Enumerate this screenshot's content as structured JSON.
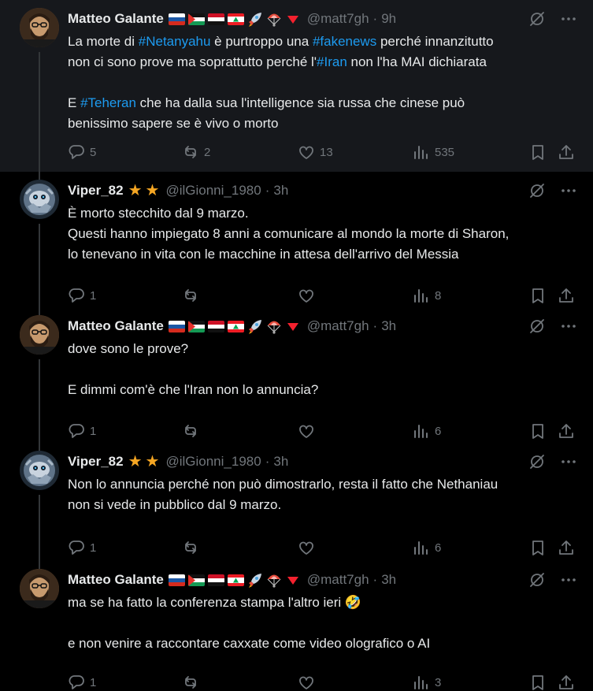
{
  "tweets": [
    {
      "name": "Matteo Galante",
      "handle": "@matt7gh",
      "time": "9h",
      "lines": [
        [
          {
            "t": "La morte di "
          },
          {
            "t": "#Netanyahu",
            "tag": true
          },
          {
            "t": " è purtroppo una "
          },
          {
            "t": "#fakenews",
            "tag": true
          },
          {
            "t": " perché innanzitutto"
          }
        ],
        [
          {
            "t": "non ci sono prove ma soprattutto perché l'"
          },
          {
            "t": "#Iran",
            "tag": true
          },
          {
            "t": " non l'ha MAI dichiarata"
          }
        ],
        [],
        [
          {
            "t": "E "
          },
          {
            "t": "#Teheran",
            "tag": true
          },
          {
            "t": " che ha dalla sua l'intelligence sia russa che cinese può"
          }
        ],
        [
          {
            "t": "benissimo sapere se è vivo o morto"
          }
        ]
      ],
      "replies": "5",
      "reposts": "2",
      "likes": "13",
      "views": "535"
    },
    {
      "name": "Viper_82",
      "handle": "@ilGionni_1980",
      "time": "3h",
      "lines": [
        [
          {
            "t": "È morto stecchito dal 9 marzo."
          }
        ],
        [
          {
            "t": "Questi hanno impiegato 8 anni a comunicare al mondo la morte di Sharon,"
          }
        ],
        [
          {
            "t": "lo tenevano in vita con le macchine in attesa dell'arrivo del Messia"
          }
        ]
      ],
      "replies": "1",
      "reposts": "",
      "likes": "",
      "views": "8"
    },
    {
      "name": "Matteo Galante",
      "handle": "@matt7gh",
      "time": "3h",
      "lines": [
        [
          {
            "t": "dove sono le prove?"
          }
        ],
        [],
        [
          {
            "t": "E dimmi com'è che l'Iran non lo annuncia?"
          }
        ]
      ],
      "replies": "1",
      "reposts": "",
      "likes": "",
      "views": "6"
    },
    {
      "name": "Viper_82",
      "handle": "@ilGionni_1980",
      "time": "3h",
      "lines": [
        [
          {
            "t": "Non lo annuncia perché non può dimostrarlo, resta il fatto che Nethaniau"
          }
        ],
        [
          {
            "t": "non si vede in pubblico dal 9 marzo."
          }
        ]
      ],
      "replies": "1",
      "reposts": "",
      "likes": "",
      "views": "6"
    },
    {
      "name": "Matteo Galante",
      "handle": "@matt7gh",
      "time": "3h",
      "lines": [
        [
          {
            "t": "ma se ha fatto la conferenza stampa l'altro ieri "
          },
          {
            "t": "🤣",
            "emoji": true
          }
        ],
        [],
        [
          {
            "t": "e non venire a raccontare caxxate come video olografico o AI"
          }
        ]
      ],
      "replies": "1",
      "reposts": "",
      "likes": "",
      "views": "3"
    }
  ],
  "icons": {
    "reply": "reply-icon",
    "repost": "repost-icon",
    "like": "like-icon",
    "views": "views-icon",
    "bookmark": "bookmark-icon",
    "share": "share-icon",
    "grok": "grok-icon",
    "more": "more-icon"
  },
  "colors": {
    "accent": "#1d9bf0",
    "muted": "#71767b",
    "star": "#f5a623"
  }
}
